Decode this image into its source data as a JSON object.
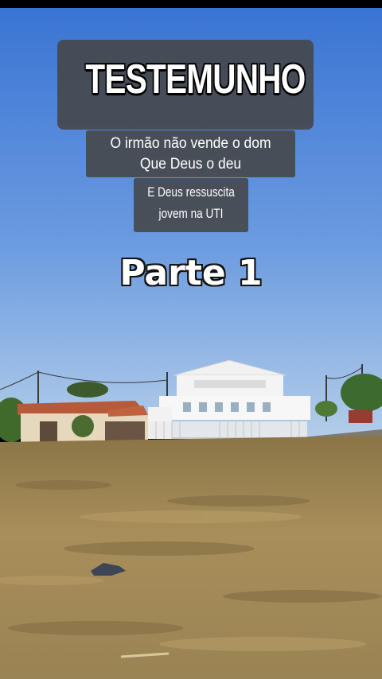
{
  "video": {
    "title": "TESTEMUNHO",
    "subtitle_line1": "O irmão não vende o dom",
    "subtitle_line2": "Que Deus o deu",
    "caption_line1": "E Deus ressuscita",
    "caption_line2": "jovem na UTI",
    "part_label": "Parte 1"
  },
  "colors": {
    "sky_top": "#3e79d6",
    "sky_bottom": "#a9c6e6",
    "grass": "#9d8553",
    "caption_bg": "#464646"
  }
}
